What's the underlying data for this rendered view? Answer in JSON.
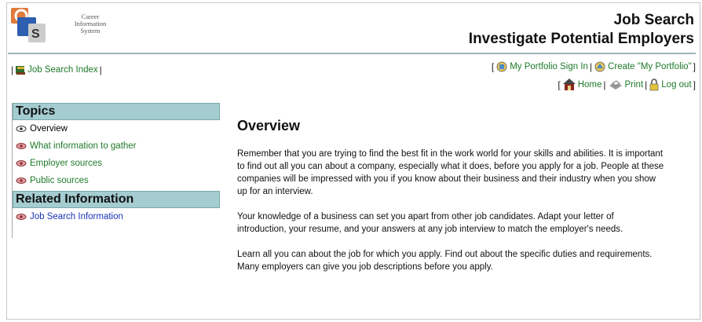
{
  "header": {
    "logo_text": [
      "Career",
      "Information",
      "System"
    ],
    "title_line1": "Job Search",
    "title_line2": "Investigate Potential Employers"
  },
  "nav": {
    "job_search_index": "Job Search Index",
    "portfolio_sign_in": "My Portfolio Sign In",
    "create_portfolio": "Create \"My Portfolio\"",
    "home": "Home",
    "print": "Print",
    "log_out": "Log out"
  },
  "sidebar": {
    "topics_heading": "Topics",
    "topics": [
      "Overview",
      "What information to gather",
      "Employer sources",
      "Public sources"
    ],
    "related_heading": "Related Information",
    "related": [
      "Job Search Information"
    ]
  },
  "main": {
    "heading": "Overview",
    "paragraphs": [
      "Remember that you are trying to find the best fit in the work world for your skills and abilities. It is important to find out all you can about a company, especially what it does, before you apply for a job. People at these companies will be impressed with you if you know about their business and their industry when you show up for an interview.",
      "Your knowledge of a business can set you apart from other job candidates. Adapt your letter of introduction, your resume, and your answers at any job interview to match the employer's needs.",
      "Learn all you can about the job for which you apply. Find out about the specific duties and requirements. Many employers can give you job descriptions before you apply."
    ]
  },
  "colors": {
    "link_green": "#1e7a2a",
    "related_blue": "#1a33b5",
    "section_header_bg": "#a4ccd1"
  }
}
